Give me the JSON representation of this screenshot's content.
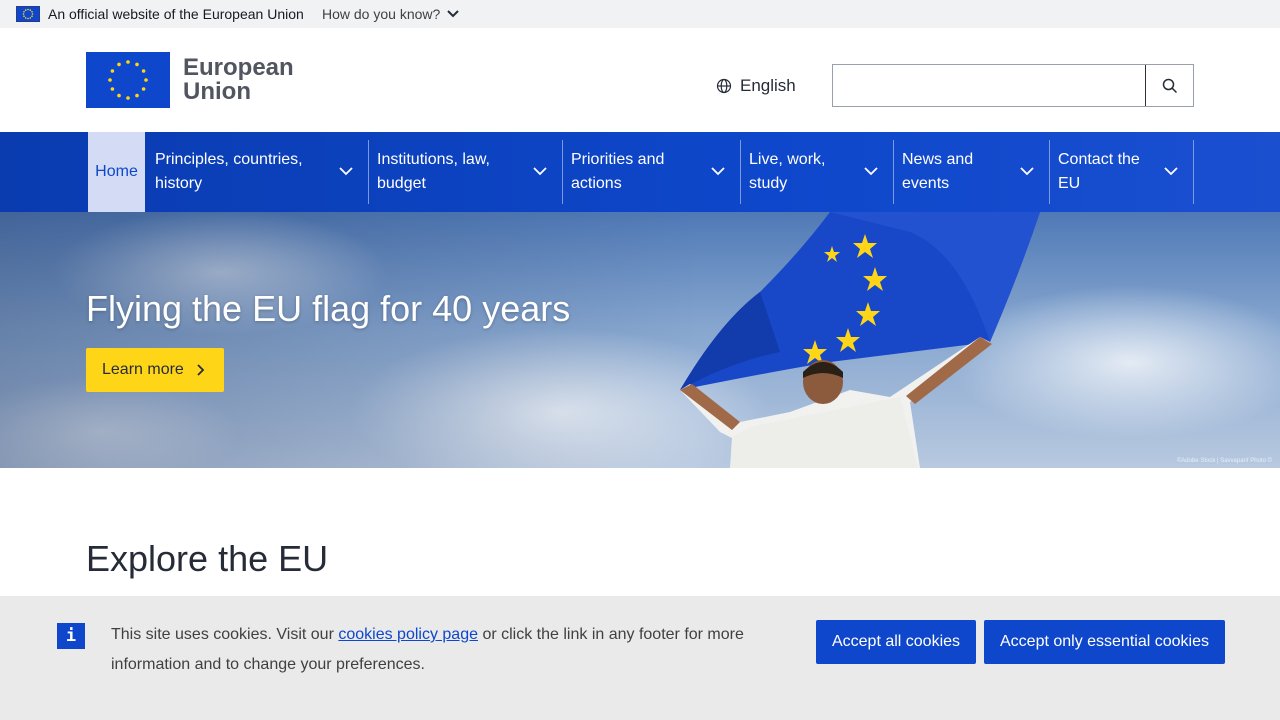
{
  "official_bar": {
    "text": "An official website of the European Union",
    "how_label": "How do you know?"
  },
  "header": {
    "logo_line1": "European",
    "logo_line2": "Union",
    "language": "English",
    "search": {
      "value": "",
      "placeholder": ""
    }
  },
  "nav": {
    "home": "Home",
    "items": [
      {
        "line1": "Principles, countries,",
        "line2": "history"
      },
      {
        "line1": "Institutions, law,",
        "line2": "budget"
      },
      {
        "line1": "Priorities and",
        "line2": "actions"
      },
      {
        "line1": "Live, work,",
        "line2": "study"
      },
      {
        "line1": "News and",
        "line2": "events"
      },
      {
        "line1": "Contact the",
        "line2": "EU"
      }
    ]
  },
  "hero": {
    "title": "Flying the EU flag for 40 years",
    "button": "Learn more",
    "credit": "©Adobe Stock | Savvapanf Photo ©"
  },
  "main": {
    "section_title": "Explore the EU"
  },
  "cookie": {
    "text_before": "This site uses cookies. Visit our ",
    "link": "cookies policy page",
    "text_after": " or click the link in any footer for more information and to change your preferences.",
    "accept_all": "Accept all cookies",
    "accept_essential": "Accept only essential cookies"
  },
  "colors": {
    "eu_blue": "#0e47cb",
    "eu_yellow": "#ffd617",
    "home_highlight": "#d3dcf4"
  }
}
